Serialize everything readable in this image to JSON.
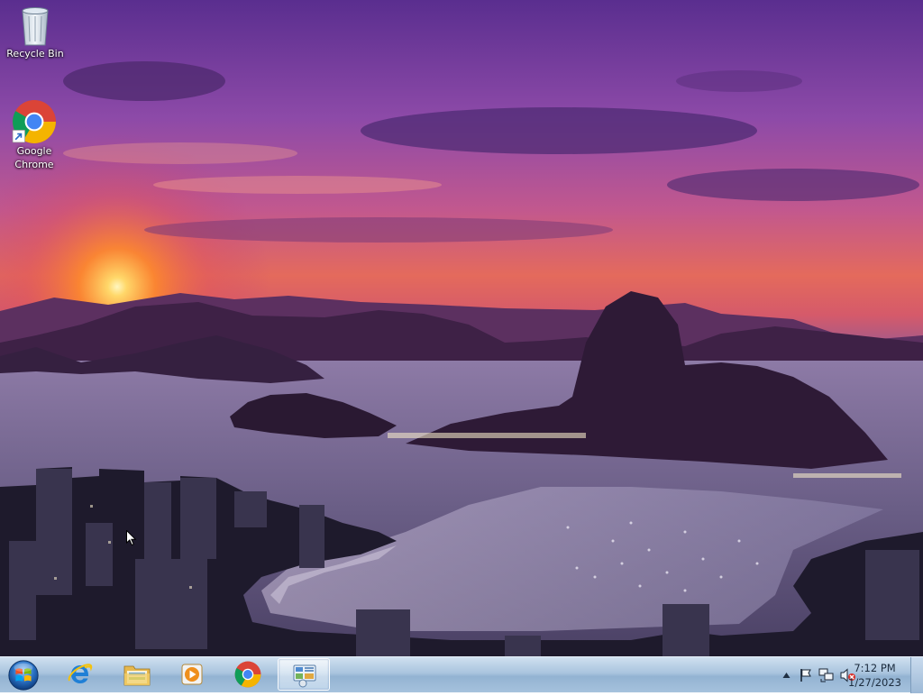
{
  "desktop": {
    "icons": [
      {
        "label": "Recycle Bin",
        "icon": "recycle-bin-icon"
      },
      {
        "label": "Google\nChrome",
        "icon": "chrome-icon"
      }
    ]
  },
  "taskbar": {
    "start": {
      "icon": "windows-start-orb-icon"
    },
    "pinned": [
      {
        "app": "Internet Explorer",
        "icon": "internet-explorer-icon"
      },
      {
        "app": "Windows Explorer",
        "icon": "folder-explorer-icon"
      },
      {
        "app": "Windows Media Player",
        "icon": "media-player-icon"
      },
      {
        "app": "Google Chrome",
        "icon": "chrome-icon"
      },
      {
        "app": "Control Panel",
        "icon": "control-panel-icon",
        "active": true
      }
    ],
    "tray": {
      "icons": [
        "show-hidden-icons-arrow",
        "action-center-flag-icon",
        "network-icon",
        "volume-muted-icon"
      ],
      "time": "7:12 PM",
      "date": "1/27/2023"
    }
  },
  "colors": {
    "taskbar_top": "#cfe0f0",
    "taskbar_bottom": "#93b3d2",
    "sky_purple": "#7a3f9e",
    "sun_orange": "#ff8a2a"
  }
}
